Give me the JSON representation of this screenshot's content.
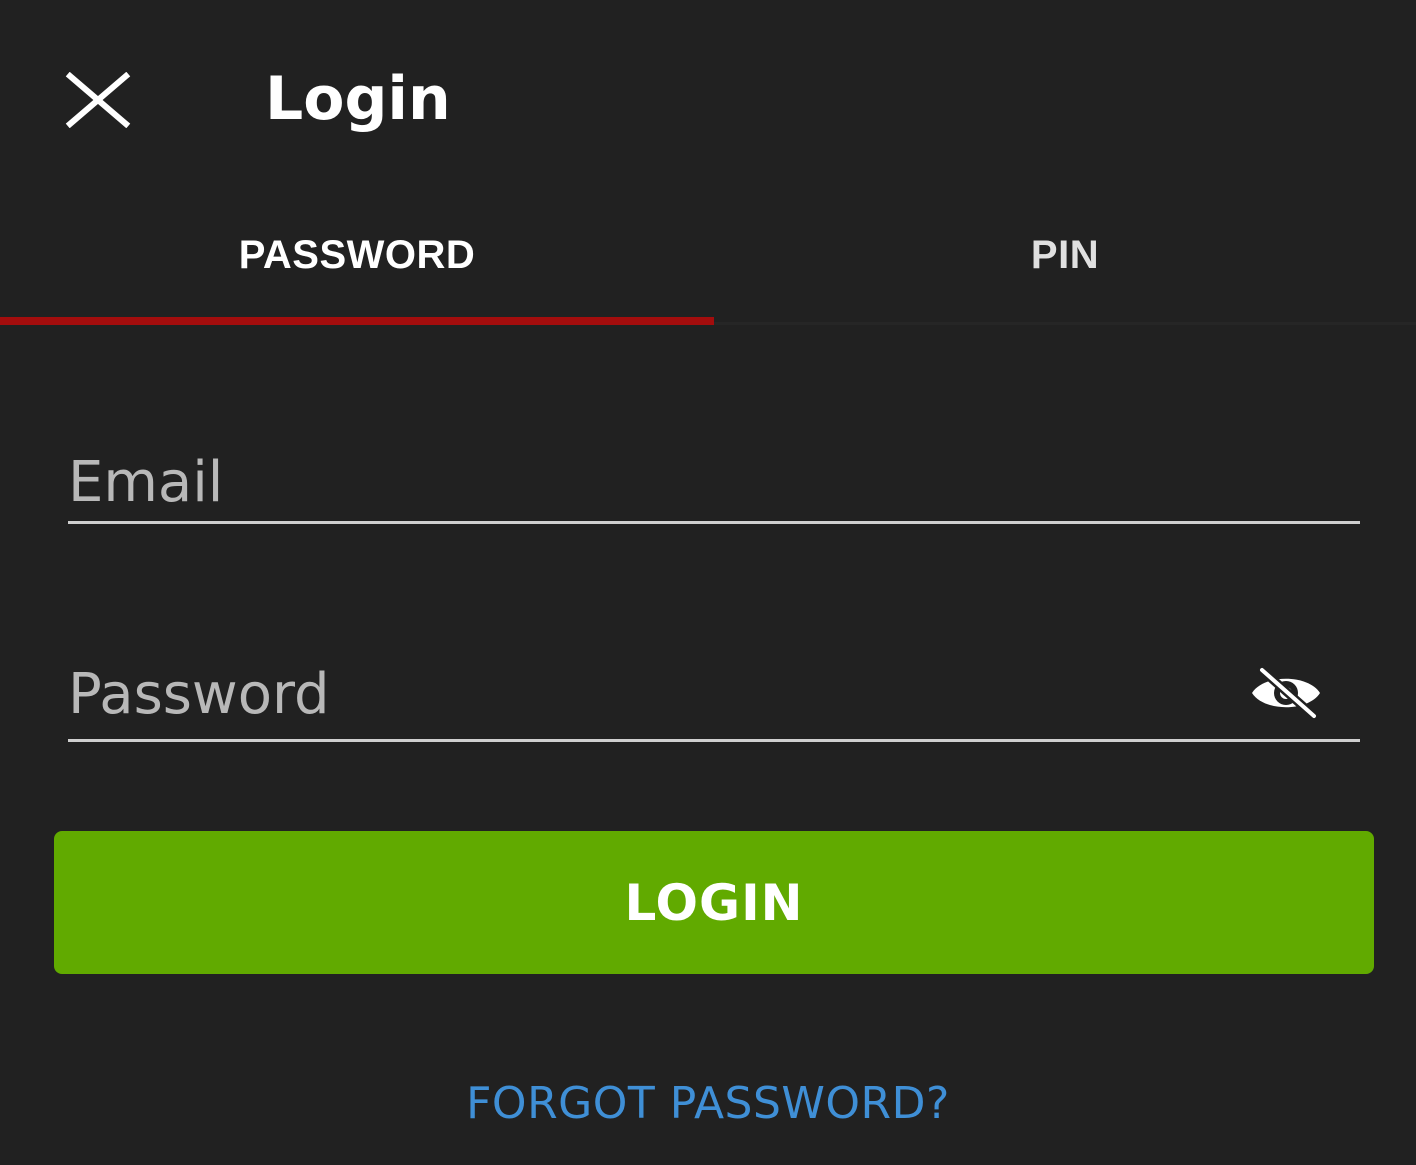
{
  "header": {
    "close_icon": "close-icon",
    "title": "Login"
  },
  "tabs": [
    {
      "label": "PASSWORD",
      "active": true
    },
    {
      "label": "PIN",
      "active": false
    }
  ],
  "form": {
    "email": {
      "placeholder": "Email",
      "value": ""
    },
    "password": {
      "placeholder": "Password",
      "value": "",
      "toggle_icon": "eye-off-icon"
    },
    "login_label": "LOGIN",
    "forgot_label": "FORGOT PASSWORD?"
  },
  "colors": {
    "background": "#212121",
    "tab_indicator": "#a30d0d",
    "login_button": "#61aa00",
    "link": "#3f8fd6"
  }
}
